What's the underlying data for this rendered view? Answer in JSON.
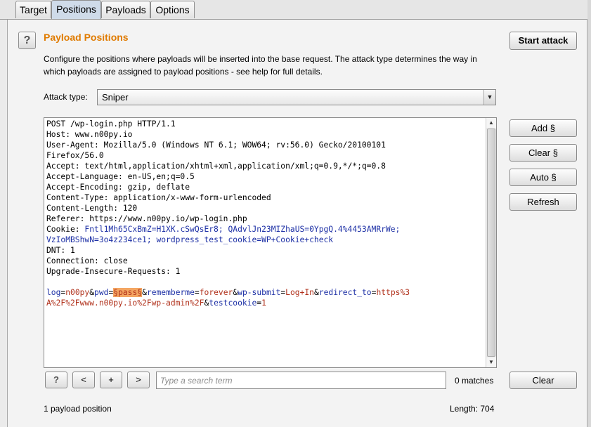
{
  "tabs": [
    "Target",
    "Positions",
    "Payloads",
    "Options"
  ],
  "title": "Payload Positions",
  "description": "Configure the positions where payloads will be inserted into the base request. The attack type determines the way in which payloads are assigned to payload positions - see help for full details.",
  "start_attack_label": "Start attack",
  "attack_type": {
    "label": "Attack type:",
    "value": "Sniper"
  },
  "side_buttons": {
    "add": "Add §",
    "clear": "Clear §",
    "auto": "Auto §",
    "refresh": "Refresh"
  },
  "request": {
    "headers": [
      "POST /wp-login.php HTTP/1.1",
      "Host: www.n00py.io",
      "User-Agent: Mozilla/5.0 (Windows NT 6.1; WOW64; rv:56.0) Gecko/20100101",
      "Firefox/56.0",
      "Accept: text/html,application/xhtml+xml,application/xml;q=0.9,*/*;q=0.8",
      "Accept-Language: en-US,en;q=0.5",
      "Accept-Encoding: gzip, deflate",
      "Content-Type: application/x-www-form-urlencoded",
      "Content-Length: 120",
      "Referer: https://www.n00py.io/wp-login.php"
    ],
    "cookie_label": "Cookie: ",
    "cookie_name1": "Fntl1Mh65CxBmZ=H1XK.cSwQsEr8;",
    "cookie_name2": "QAdvlJn23MIZhaUS=0YpgQ.4%4453AMRrWe;",
    "cookie_name3": "VzIoMBShwN=3o4z234ce1;",
    "cookie_name4": "wordpress_test_cookie=WP+Cookie+check",
    "headers_after": [
      "DNT: 1",
      "Connection: close",
      "Upgrade-Insecure-Requests: 1"
    ],
    "body_parts": {
      "log_key": "log",
      "eq": "=",
      "log_val": "n00py",
      "amp": "&",
      "pwd_key": "pwd",
      "pwd_marker": "§pass§",
      "rememberme_key": "rememberme",
      "rememberme_val": "forever",
      "submit_key": "wp-submit",
      "submit_val": "Log+In",
      "redirect_key": "redirect_to",
      "redirect_val_line1": "https%3",
      "redirect_val_line2": "A%2F%2Fwww.n00py.io%2Fwp-admin%2F",
      "testcookie_key": "testcookie",
      "testcookie_val": "1"
    }
  },
  "nav_buttons": {
    "help": "?",
    "prev": "<",
    "add": "+",
    "next": ">"
  },
  "search": {
    "placeholder": "Type a search term",
    "value": ""
  },
  "matches": "0 matches",
  "clear_label": "Clear",
  "status": {
    "positions": "1 payload position",
    "length": "Length: 704"
  },
  "colors": {
    "title": "#e07b00",
    "param_name": "#1c2fa5",
    "param_value": "#b0301a",
    "payload_highlight": "#f4a662"
  }
}
